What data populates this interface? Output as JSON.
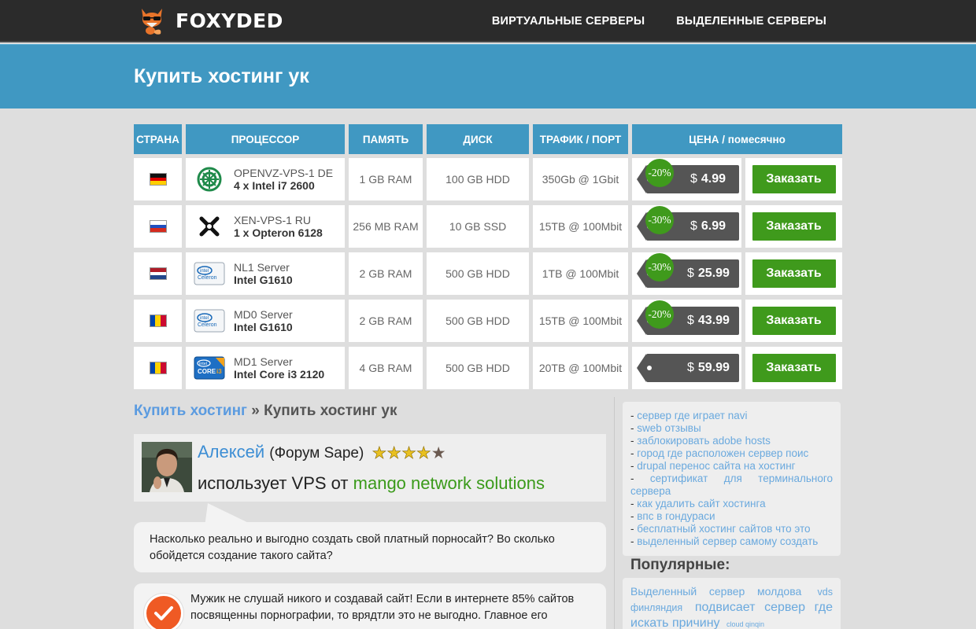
{
  "brand": {
    "name": "FOXYDED"
  },
  "nav": {
    "items": [
      {
        "label": "ВИРТУАЛЬНЫЕ СЕРВЕРЫ"
      },
      {
        "label": "ВЫДЕЛЕННЫЕ СЕРВЕРЫ"
      }
    ]
  },
  "page": {
    "title": "Купить хостинг ук"
  },
  "table": {
    "headers": [
      "СТРАНА",
      "ПРОЦЕССОР",
      "ПАМЯТЬ",
      "ДИСК",
      "ТРАФИК / ПОРТ",
      "ЦЕНА / помесячно"
    ],
    "currency": "$",
    "order_label": "Заказать",
    "rows": [
      {
        "flag": "de",
        "cpu_icon": "openvz-icon",
        "plan": "OPENVZ-VPS-1 DE",
        "cpu": "4 x Intel i7 2600",
        "ram": "1 GB RAM",
        "disk": "100 GB HDD",
        "traffic": "350Gb @ 1Gbit",
        "discount": "-20%",
        "price": "4.99"
      },
      {
        "flag": "ru",
        "cpu_icon": "xen-icon",
        "plan": "XEN-VPS-1 RU",
        "cpu": "1 x Opteron 6128",
        "ram": "256 MB RAM",
        "disk": "10 GB SSD",
        "traffic": "15TB @ 100Mbit",
        "discount": "-30%",
        "price": "6.99"
      },
      {
        "flag": "nl",
        "cpu_icon": "intel-celeron-icon",
        "plan": "NL1 Server",
        "cpu": "Intel G1610",
        "ram": "2 GB RAM",
        "disk": "500 GB HDD",
        "traffic": "1TB @ 100Mbit",
        "discount": "-30%",
        "price": "25.99"
      },
      {
        "flag": "md",
        "cpu_icon": "intel-celeron-icon",
        "plan": "MD0 Server",
        "cpu": "Intel G1610",
        "ram": "2 GB RAM",
        "disk": "500 GB HDD",
        "traffic": "15TB @ 100Mbit",
        "discount": "-20%",
        "price": "43.99"
      },
      {
        "flag": "md",
        "cpu_icon": "intel-core-i3-icon",
        "plan": "MD1 Server",
        "cpu": "Intel Core i3 2120",
        "ram": "4 GB RAM",
        "disk": "500 GB HDD",
        "traffic": "20TB @ 100Mbit",
        "discount": "",
        "price": "59.99"
      }
    ]
  },
  "breadcrumb": {
    "link": "Купить хостинг",
    "separator": "»",
    "current": "Купить хостинг ук"
  },
  "testimonial": {
    "name": "Алексей",
    "source": "(Форум Sape)",
    "rating": 4,
    "rating_max": 5,
    "text_prefix": "использует VPS от",
    "company": "mango network solutions"
  },
  "question": "Насколько реально и выгодно создать свой платный порносайт? Во сколько обойдется создание такого сайта?",
  "answer": "Мужик не слушай никого и создавай сайт! Если в интернете 85% сайтов посвященны порнографии, то врядтли это не выгодно. Главное его",
  "sidebar": {
    "links": [
      "сервер где играет navi",
      "sweb отзывы",
      "заблокировать adobe hosts",
      "город где расположен сервер поис",
      "drupal перенос сайта на хостинг",
      "сертификат для терминального сервера",
      "как удалить сайт хостинга",
      "впс в гондураси",
      "бесплатный хостинг сайтов что это",
      "выделенный сервер самому создать"
    ],
    "popular_title": "Популярные:",
    "popular_tags": [
      "Выделенный сервер молдова",
      "vds финляндия",
      "подвисает сервер где искать причину",
      "cloud qinqin"
    ]
  },
  "colors": {
    "accent_blue": "#4098c2",
    "order_green": "#3f9a1c",
    "link_blue": "#6aa9de",
    "topbar": "#2b2b2b"
  }
}
